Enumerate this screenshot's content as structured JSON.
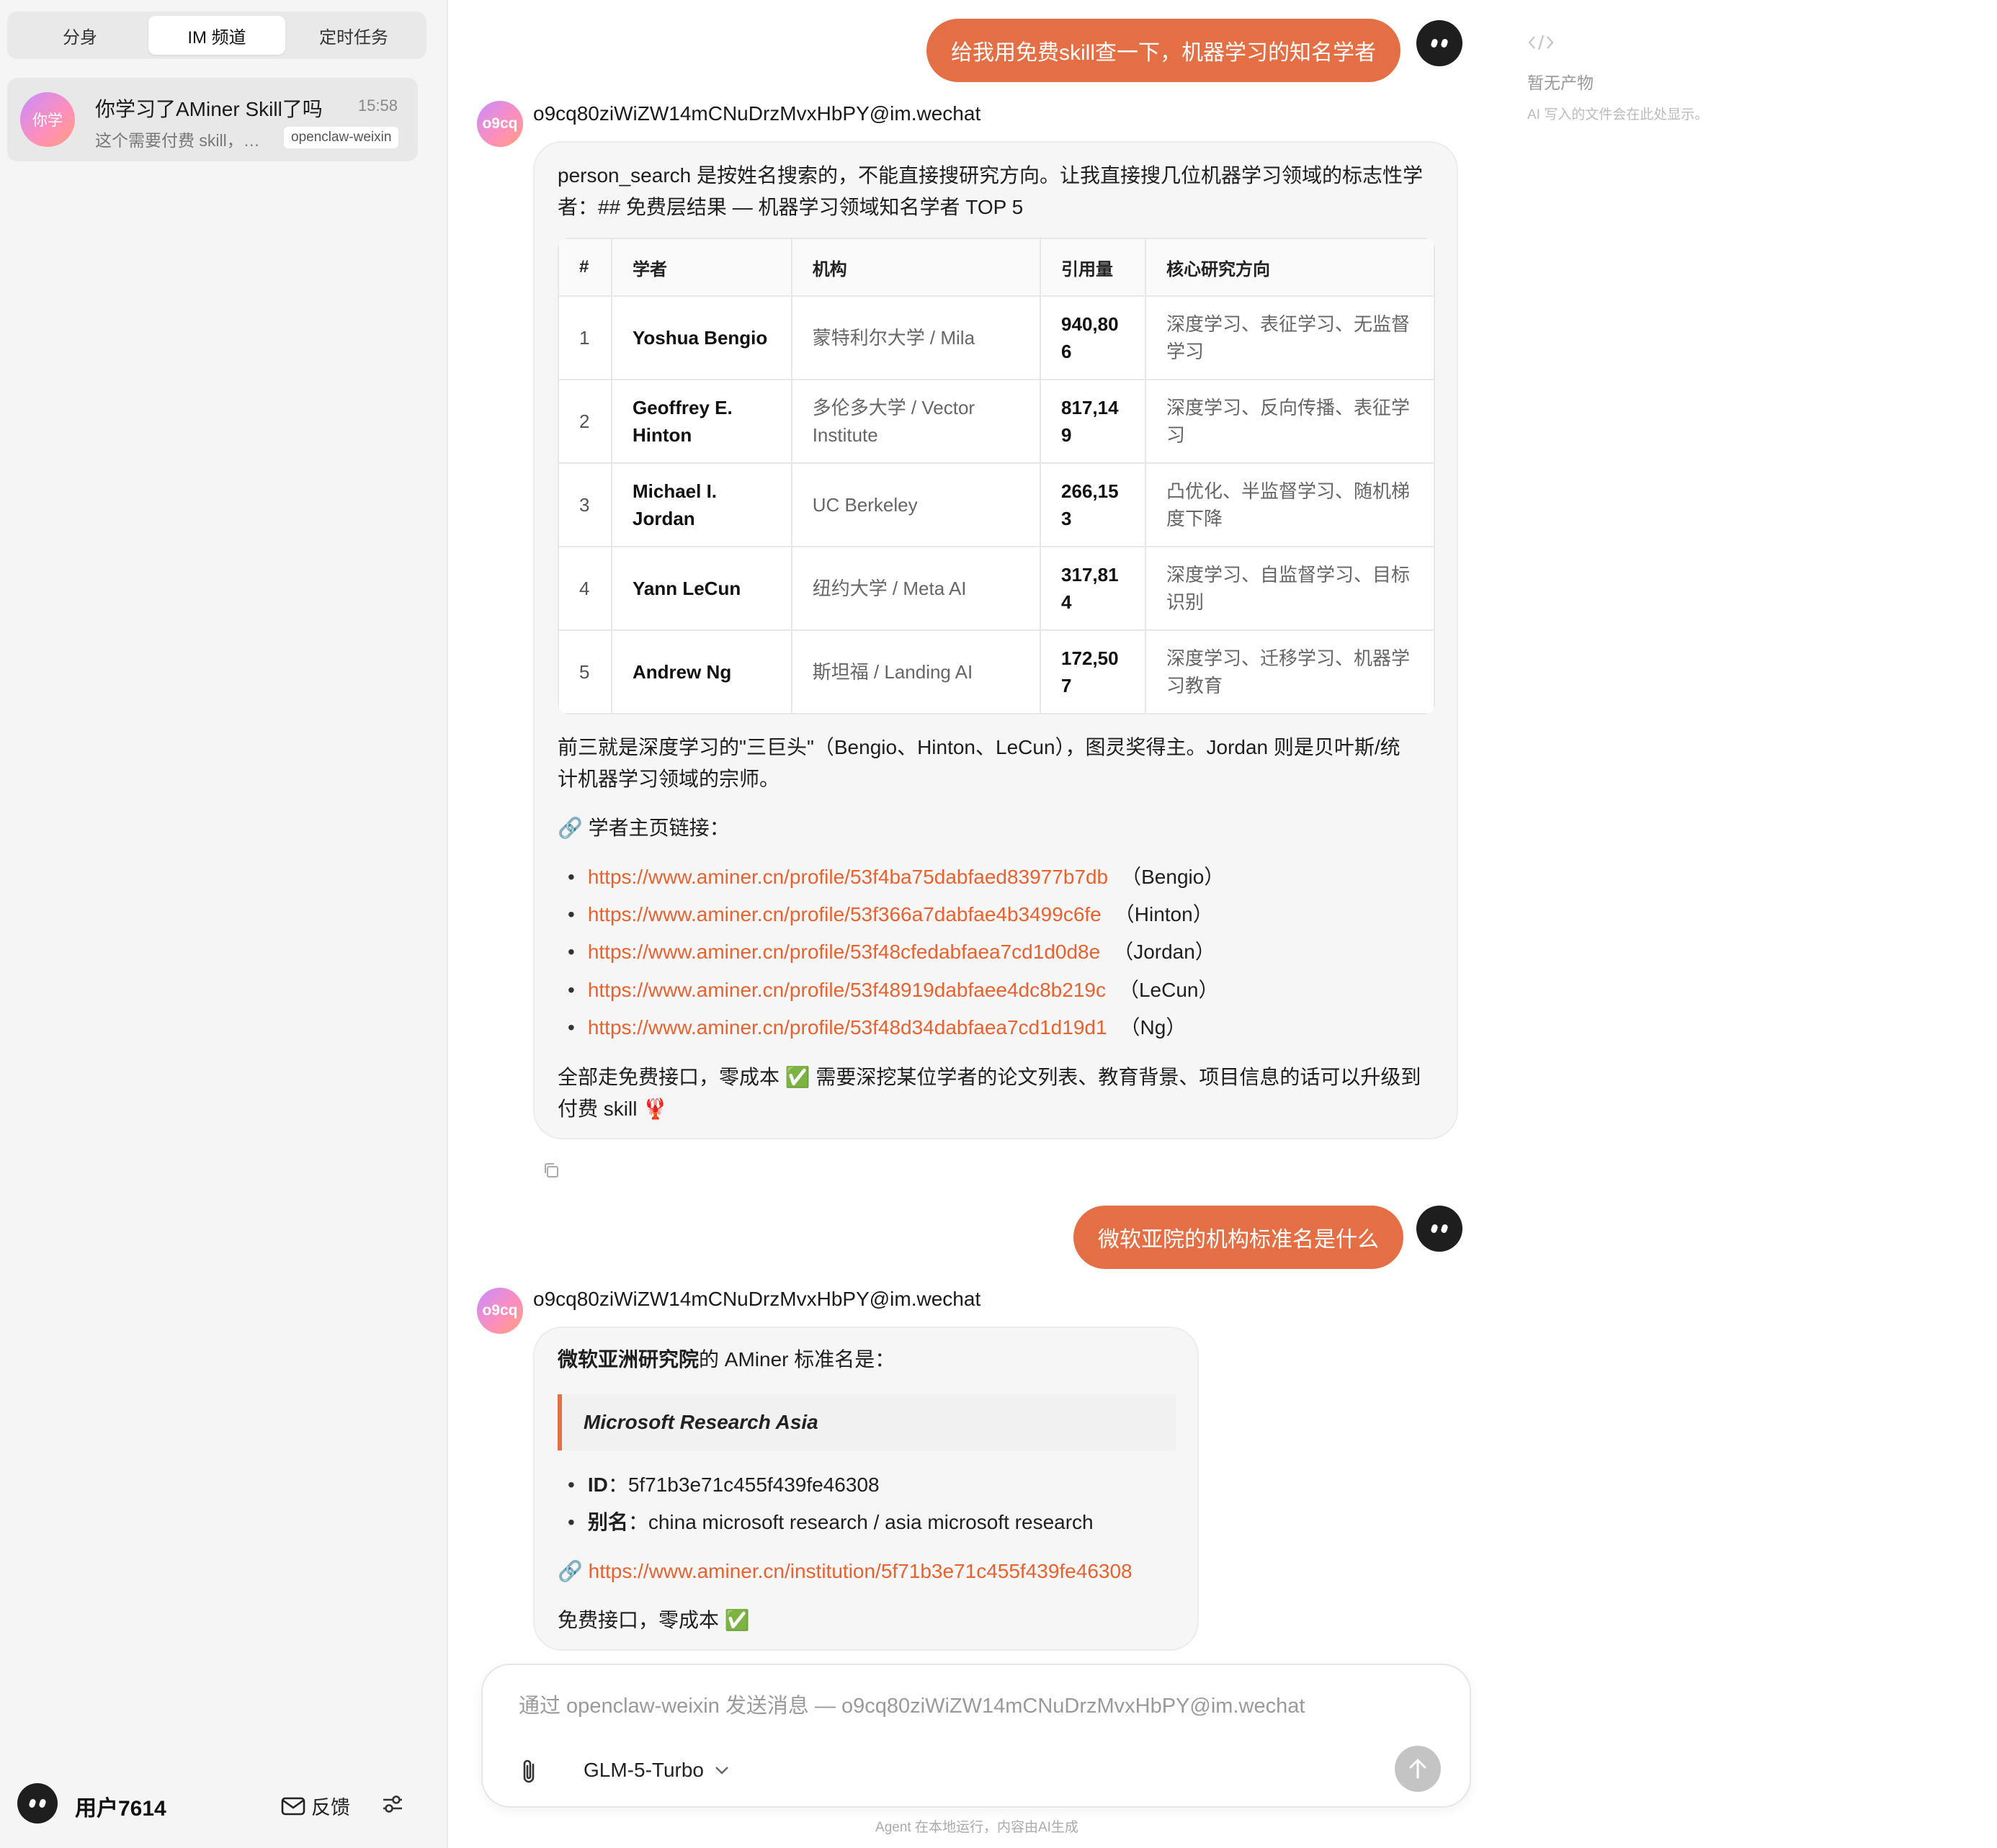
{
  "sidebar": {
    "tabs": [
      "分身",
      "IM 频道",
      "定时任务"
    ],
    "conversation": {
      "avatar_text": "你学",
      "title": "你学习了AMiner Skill了吗",
      "time": "15:58",
      "preview": "这个需要付费 skill，…",
      "channel": "openclaw-weixin"
    },
    "user": {
      "name": "用户7614",
      "feedback_label": "反馈"
    }
  },
  "chat": {
    "msg1": {
      "text": "给我用免费skill查一下，机器学习的知名学者"
    },
    "reply1": {
      "avatar_text": "o9cq",
      "sender": "o9cq80ziWiZW14mCNuDrzMvxHbPY@im.wechat",
      "intro_line1": "person_search 是按姓名搜索的，不能直接搜研究方向。让我直接搜几位机器学习领域的标志性学",
      "intro_line2": "者：## 免费层结果 — 机器学习领域知名学者 TOP 5",
      "table": {
        "headers": [
          "#",
          "学者",
          "机构",
          "引用量",
          "核心研究方向"
        ],
        "rows": [
          {
            "rank": "1",
            "name": "Yoshua Bengio",
            "org": "蒙特利尔大学 / Mila",
            "cit1": "940,80",
            "cit2": "6",
            "dir1": "深度学习、表征学习、无监督",
            "dir2": "学习"
          },
          {
            "rank": "2",
            "name": "Geoffrey E.",
            "name2": "Hinton",
            "org": "多伦多大学 / Vector",
            "org2": "Institute",
            "cit1": "817,14",
            "cit2": "9",
            "dir1": "深度学习、反向传播、表征学",
            "dir2": "习"
          },
          {
            "rank": "3",
            "name": "Michael I.",
            "name2": "Jordan",
            "org": "UC Berkeley",
            "cit1": "266,15",
            "cit2": "3",
            "dir1": "凸优化、半监督学习、随机梯",
            "dir2": "度下降"
          },
          {
            "rank": "4",
            "name": "Yann LeCun",
            "org": "纽约大学 / Meta AI",
            "cit1": "317,81",
            "cit2": "4",
            "dir1": "深度学习、自监督学习、目标",
            "dir2": "识别"
          },
          {
            "rank": "5",
            "name": "Andrew Ng",
            "org": "斯坦福 / Landing AI",
            "cit1": "172,50",
            "cit2": "7",
            "dir1": "深度学习、迁移学习、机器学",
            "dir2": "习教育"
          }
        ]
      },
      "summary_line1": "前三就是深度学习的\"三巨头\"（Bengio、Hinton、LeCun），图灵奖得主。Jordan 则是贝叶斯/统",
      "summary_line2": "计机器学习领域的宗师。",
      "links_heading": "🔗 学者主页链接：",
      "links": [
        {
          "url": "https://www.aminer.cn/profile/53f4ba75dabfaed83977b7db",
          "who": "（Bengio）"
        },
        {
          "url": "https://www.aminer.cn/profile/53f366a7dabfae4b3499c6fe",
          "who": "（Hinton）"
        },
        {
          "url": "https://www.aminer.cn/profile/53f48cfedabfaea7cd1d0d8e",
          "who": "（Jordan）"
        },
        {
          "url": "https://www.aminer.cn/profile/53f48919dabfaee4dc8b219c",
          "who": "（LeCun）"
        },
        {
          "url": "https://www.aminer.cn/profile/53f48d34dabfaea7cd1d19d1",
          "who": "（Ng）"
        }
      ],
      "closing_line1": "全部走免费接口，零成本 ✅ 需要深挖某位学者的论文列表、教育背景、项目信息的话可以升级到",
      "closing_line2": "付费 skill 🦞"
    },
    "msg2": {
      "text": "微软亚院的机构标准名是什么"
    },
    "reply2": {
      "avatar_text": "o9cq",
      "sender": "o9cq80ziWiZW14mCNuDrzMvxHbPY@im.wechat",
      "intro_bold": "微软亚洲研究院",
      "intro_rest": "的 AMiner 标准名是：",
      "quote": "Microsoft Research Asia",
      "id_label": "ID",
      "id_value": "：5f71b3e71c455f439fe46308",
      "alias_label": "别名",
      "alias_value": "：china microsoft research / asia microsoft research",
      "link_prefix": "🔗 ",
      "link": "https://www.aminer.cn/institution/5f71b3e71c455f439fe46308",
      "closing": "免费接口，零成本 ✅"
    }
  },
  "composer": {
    "placeholder": "通过 openclaw-weixin 发送消息 — o9cq80ziWiZW14mCNuDrzMvxHbPY@im.wechat",
    "model": "GLM-5-Turbo",
    "footnote": "Agent 在本地运行，内容由AI生成"
  },
  "artifacts": {
    "icon": "code-icon",
    "title": "暂无产物",
    "subtitle": "AI 写入的文件会在此处显示。"
  },
  "colors": {
    "accent": "#e56f45",
    "link": "#e8622f",
    "sidebar_bg": "#f5f5f5"
  }
}
